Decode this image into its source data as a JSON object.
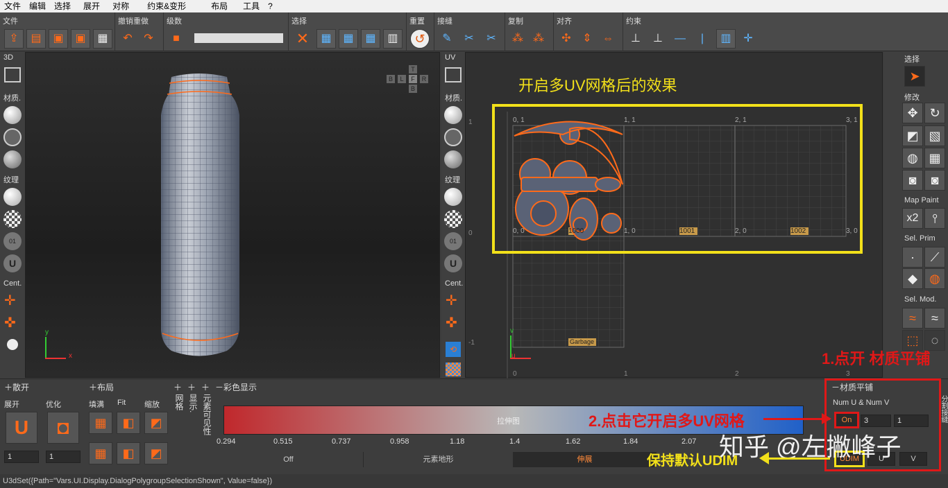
{
  "menu": [
    "文件",
    "编辑",
    "选择",
    "展开",
    "对称",
    "约束&变形",
    "布局",
    "工具",
    "?"
  ],
  "toolbar": {
    "file": "文件",
    "undo": "撤销重做",
    "levels": "级数",
    "select": "选择",
    "reset": "重置",
    "seam": "接缝",
    "copy": "复制",
    "align": "对齐",
    "constraint": "约束"
  },
  "left": {
    "view3d": "3D",
    "material": "材质.",
    "texture": "纹理",
    "cent": "Cent."
  },
  "uvside": {
    "uv": "UV",
    "material": "材质.",
    "texture": "纹理",
    "cent": "Cent."
  },
  "right": {
    "select": "选择",
    "modify": "修改",
    "map_paint": "Map Paint",
    "sel_prim": "Sel. Prim",
    "sel_mod": "Sel. Mod."
  },
  "viewcube": [
    "T",
    "B",
    "L",
    "F",
    "R",
    "B"
  ],
  "axes3d": {
    "y": "y",
    "x": "x"
  },
  "uv": {
    "overlay_title": "开启多UV网格后的效果",
    "top_labels": [
      "0, 1",
      "1, 1",
      "2, 1",
      "3, 1"
    ],
    "mid_labels": [
      "0, 0",
      "1, 0",
      "2, 0",
      "3, 0"
    ],
    "left_ticks": [
      "1",
      "0",
      "-1"
    ],
    "bottom_ticks": [
      "0",
      "1",
      "2",
      "3"
    ],
    "tiles": [
      "1000",
      "1001",
      "1002"
    ],
    "garbage": "Garbage",
    "axis_v": "v",
    "axis_u": "u"
  },
  "panels": {
    "unfold": "散开",
    "layout": "布局",
    "grid_v": "网格",
    "show_v": "显示.",
    "visibility_v": "元素可见性",
    "color_display": "彩色显示",
    "unfold_lbl": "展开",
    "optimize_lbl": "优化",
    "fill_lbl": "填满",
    "fit_lbl": "Fit",
    "scale_lbl": "缩放",
    "unfold_val": "1",
    "optimize_val": "1"
  },
  "colorbar": {
    "center_label": "拉伸图",
    "ticks": [
      "0.294",
      "0.515",
      "0.737",
      "0.958",
      "1.18",
      "1.4",
      "1.62",
      "1.84",
      "2.07"
    ],
    "low_color": "#c0282c",
    "mid_color": "#b8b8b8",
    "high_color": "#2060c8"
  },
  "mode_tabs": [
    "Off",
    "元素地形",
    "伸展"
  ],
  "tiling": {
    "title": "材质平铺",
    "num_label": "Num U & Num V",
    "on_label": "On",
    "u_val": "3",
    "v_val": "1",
    "mode": "UDIM",
    "side_u": "U",
    "side_v": "V",
    "vertical": "分割接缝"
  },
  "annotations": {
    "step1": "1.点开 材质平铺",
    "step2": "2.点击它开启多UV网格",
    "keep": "保持默认UDIM",
    "watermark": "知乎 @左撇峰子"
  },
  "status": "U3dSet({Path=\"Vars.UI.Display.DialogPolygroupSelectionShown\", Value=false})"
}
